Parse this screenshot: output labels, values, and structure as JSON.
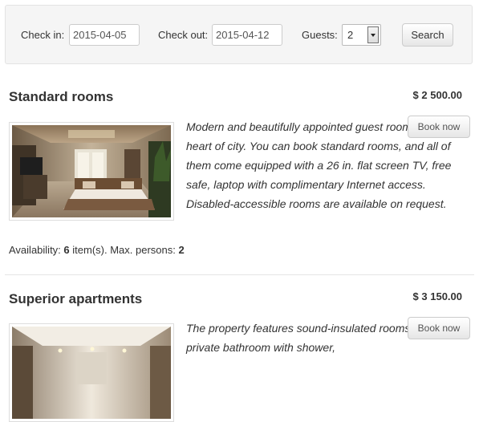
{
  "search": {
    "check_in_label": "Check in:",
    "check_in_value": "2015-04-05",
    "check_out_label": "Check out:",
    "check_out_value": "2015-04-12",
    "guests_label": "Guests:",
    "guests_value": "2",
    "search_label": "Search"
  },
  "rooms": [
    {
      "title": "Standard rooms",
      "price": "$ 2 500.00",
      "description": "Modern and beautifully appointed guest rooms in the heart of city. You can book standard rooms, and all of them come equipped with a 26 in. flat screen TV, free safe, laptop with complimentary Internet access. Disabled-accessible rooms are available on request.",
      "book_label": "Book now",
      "availability_label": "Availability:",
      "availability_count": "6",
      "items_label": "item(s). Max. persons:",
      "max_persons": "2"
    },
    {
      "title": "Superior apartments",
      "price": "$ 3 150.00",
      "description": "The property features sound-insulated rooms with private bathroom with shower,",
      "book_label": "Book now"
    }
  ]
}
